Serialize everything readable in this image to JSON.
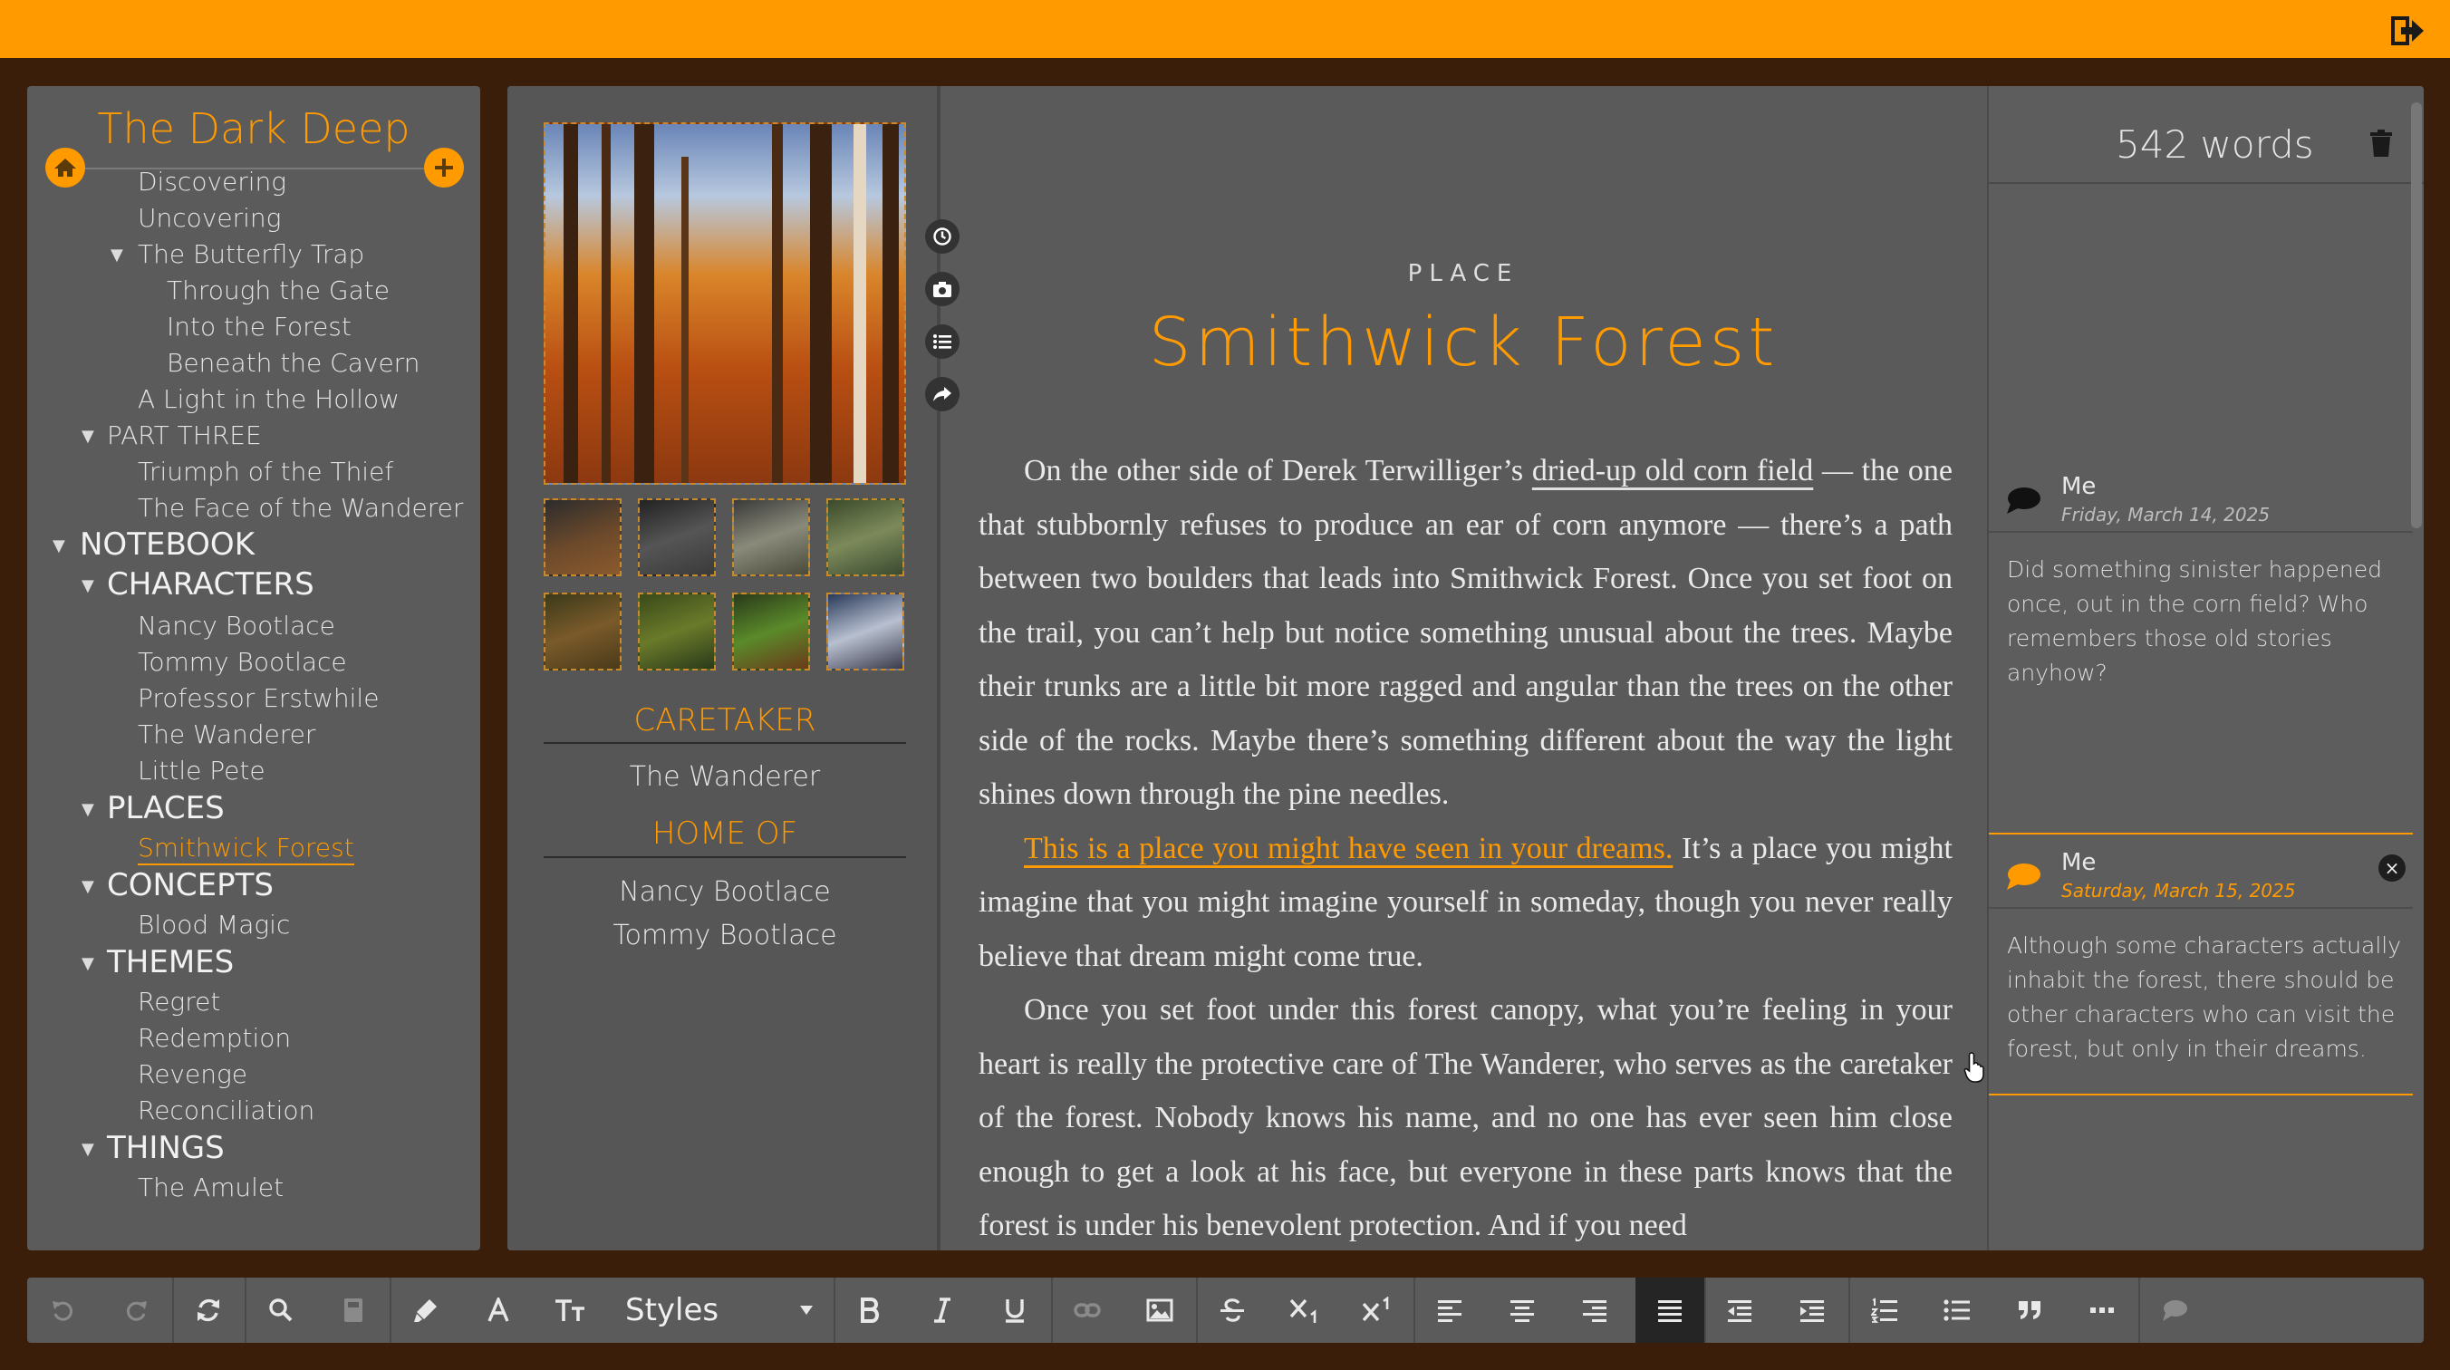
{
  "project": {
    "title": "The Dark Deep"
  },
  "sidebar": {
    "items": [
      {
        "label": "Discovering"
      },
      {
        "label": "Uncovering"
      },
      {
        "label": "The Butterfly Trap"
      },
      {
        "label": "Through the Gate"
      },
      {
        "label": "Into the Forest"
      },
      {
        "label": "Beneath the Cavern"
      },
      {
        "label": "A Light in the Hollow"
      },
      {
        "label": "PART THREE"
      },
      {
        "label": "Triumph of the Thief"
      },
      {
        "label": "The Face of the Wanderer"
      },
      {
        "label": "NOTEBOOK"
      },
      {
        "label": "CHARACTERS"
      },
      {
        "label": "Nancy Bootlace"
      },
      {
        "label": "Tommy Bootlace"
      },
      {
        "label": "Professor Erstwhile"
      },
      {
        "label": "The Wanderer"
      },
      {
        "label": "Little Pete"
      },
      {
        "label": "PLACES"
      },
      {
        "label": "Smithwick Forest"
      },
      {
        "label": "CONCEPTS"
      },
      {
        "label": "Blood Magic"
      },
      {
        "label": "THEMES"
      },
      {
        "label": "Regret"
      },
      {
        "label": "Redemption"
      },
      {
        "label": "Revenge"
      },
      {
        "label": "Reconciliation"
      },
      {
        "label": "THINGS"
      },
      {
        "label": "The Amulet"
      }
    ]
  },
  "info": {
    "caretaker_heading": "CARETAKER",
    "caretaker": [
      "The Wanderer"
    ],
    "home_heading": "HOME OF",
    "home_of": [
      "Nancy Bootlace",
      "Tommy Bootlace"
    ]
  },
  "document": {
    "type_label": "PLACE",
    "title": "Smithwick Forest",
    "p1": {
      "a": "On the other side of Derek Terwilliger’s ",
      "link": "dried-up old corn field",
      "b": " — the one that stubbornly refuses to produce an ear of corn anymore — there’s a path between two boulders that leads into Smithwick Forest. Once you set foot on the trail, you can’t help but notice something unusual about the trees. Maybe their trunks are a little bit more ragged and angular than the trees on the other side of the rocks. Maybe there’s something different about the way the light shines down through the pine needles."
    },
    "p2": {
      "link": "This is a place you might have seen in your dreams.",
      "b": " It’s a place you might imagine that you might imagine yourself in someday, though you never really believe that dream might come true."
    },
    "p3": "Once you set foot under this forest canopy, what you’re feeling in your heart is really the protective care of The Wanderer, who serves as the caretaker of the forest. Nobody knows his name, and no one has ever seen him close enough to get a look at his face, but everyone in these parts knows that the forest is under his benevolent protection. And if you need"
  },
  "stats": {
    "word_count": "542 words"
  },
  "comments": [
    {
      "author": "Me",
      "date": "Friday, March 14, 2025",
      "text": "Did something sinister happened once, out in the corn field? Who remembers those old stories anyhow?"
    },
    {
      "author": "Me",
      "date": "Saturday, March 15, 2025",
      "text": "Although some characters actually inhabit the forest, there should be other characters who can visit the forest, but only in their dreams."
    }
  ],
  "toolbar": {
    "styles_label": "Styles",
    "close_glyph": "×"
  },
  "colors": {
    "accent": "#ff9a00",
    "panel": "#5b5b5b",
    "frame": "#3a1e0a"
  }
}
